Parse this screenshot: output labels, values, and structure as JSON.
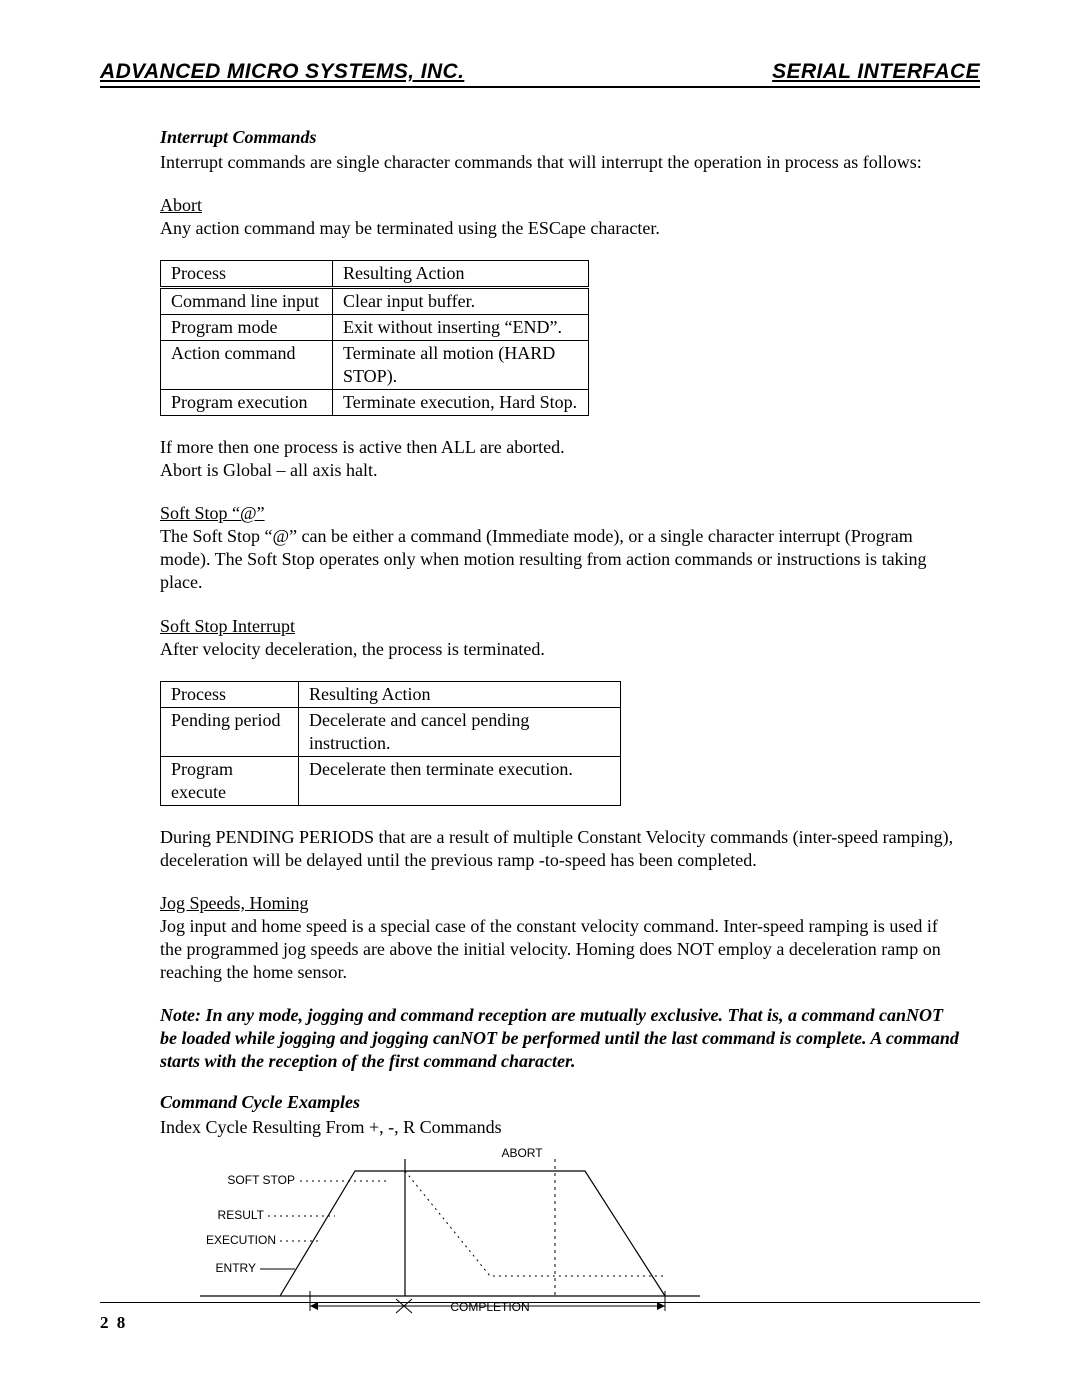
{
  "header": {
    "left": "ADVANCED MICRO SYSTEMS, INC.",
    "right": "SERIAL INTERFACE"
  },
  "section1": {
    "title": "Interrupt Commands",
    "intro": "Interrupt commands are single character commands that will interrupt the operation in process as follows:"
  },
  "abort": {
    "heading": "Abort",
    "text": "Any action command may be terminated using the ESCape character."
  },
  "table1": {
    "head": {
      "c1": "Process",
      "c2": "Resulting Action"
    },
    "rows": [
      {
        "c1": "Command line input",
        "c2": "Clear input buffer."
      },
      {
        "c1": "Program mode",
        "c2": "Exit without inserting “END”."
      },
      {
        "c1": "Action command",
        "c2": "Terminate all motion (HARD STOP)."
      },
      {
        "c1": "Program execution",
        "c2": "Terminate execution, Hard Stop."
      }
    ]
  },
  "after_table1": {
    "line1": "If more then one process is active then ALL are aborted.",
    "line2": "Abort is Global – all axis halt."
  },
  "softstop": {
    "heading": "Soft Stop “@”",
    "text": "The Soft Stop “@” can be either a command (Immediate mode), or a single character interrupt (Program mode). The Soft Stop operates only when motion resulting from action commands or instructions is taking place."
  },
  "softstop_int": {
    "heading": "Soft Stop Interrupt",
    "text": "After velocity deceleration, the process is terminated."
  },
  "table2": {
    "head": {
      "c1": "Process",
      "c2": "Resulting Action"
    },
    "rows": [
      {
        "c1": "Pending period",
        "c2": "Decelerate and cancel pending instruction."
      },
      {
        "c1": "Program execute",
        "c2": "Decelerate then terminate execution."
      }
    ]
  },
  "pending_para": "During PENDING PERIODS that are a result of multiple Constant Velocity commands (inter-speed ramping), deceleration will be delayed until the previous ramp -to-speed has been completed.",
  "jog": {
    "heading": "Jog Speeds, Homing",
    "text": "Jog input and home speed is a special case of the constant velocity command. Inter-speed ramping is used if the programmed jog speeds are above the initial velocity. Homing does NOT employ a deceleration ramp on reaching the home sensor."
  },
  "note": "Note: In any mode, jogging and command reception are mutually exclusive. That is, a command canNOT be loaded while jogging and jogging canNOT be performed until the last command is complete. A command starts with the reception of the first command character.",
  "section2": {
    "title": "Command Cycle Examples",
    "caption": "Index Cycle Resulting From +, -, R Commands"
  },
  "diagram": {
    "labels": {
      "abort": "ABORT",
      "softstop": "SOFT STOP",
      "result": "RESULT",
      "execution": "EXECUTION",
      "entry": "ENTRY",
      "completion": "COMPLETION"
    }
  },
  "page_number": "2 8"
}
